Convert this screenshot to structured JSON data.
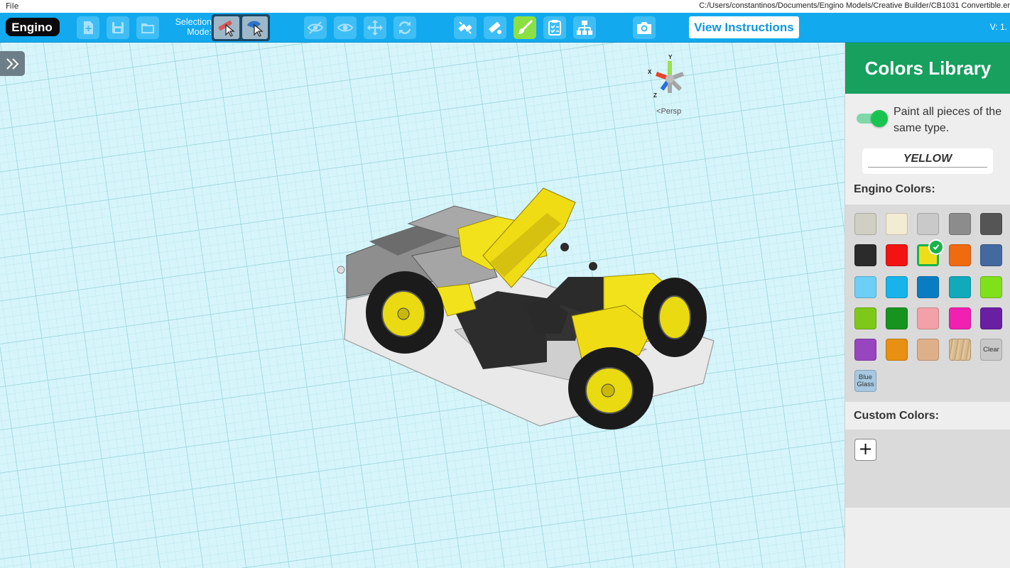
{
  "menubar": {
    "file": "File",
    "path": "C:/Users/constantinos/Documents/Engino Models/Creative Builder/CB1031 Convertible.er"
  },
  "toolbar": {
    "logo": "Engino",
    "selection_mode_label": "Selection Mode:",
    "view_instructions": "View Instructions",
    "version": "V: 1."
  },
  "viewport": {
    "camera_mode": "Persp",
    "axes": {
      "x": "X",
      "y": "Y",
      "z": "Z"
    }
  },
  "panel": {
    "title": "Colors Library",
    "paint_all": "Paint all pieces of the same type.",
    "paint_all_enabled": true,
    "selected_color": "YELLOW",
    "engino_colors_title": "Engino Colors:",
    "custom_colors_title": "Custom Colors:",
    "add_custom": "+",
    "colors": [
      "#cfcfc4",
      "#f2ecd2",
      "#c9c9c9",
      "#8c8c8c",
      "#555555",
      "#2b2b2b",
      "#f21313",
      "#f0dd1a",
      "#f06a0f",
      "#4468a0",
      "#6ccff6",
      "#16b4ea",
      "#0a7cc2",
      "#11aabb",
      "#80e01a",
      "#7ec81a",
      "#17941f",
      "#f4a0a8",
      "#f020b0",
      "#6a1fa3",
      "#9845c0",
      "#e89012",
      "#deb08a",
      "#d8b98e"
    ],
    "selected_index": 7,
    "clear_label": "Clear",
    "blue_glass_label": "Blue Glass",
    "blue_glass_color": "#a6c8e0"
  }
}
